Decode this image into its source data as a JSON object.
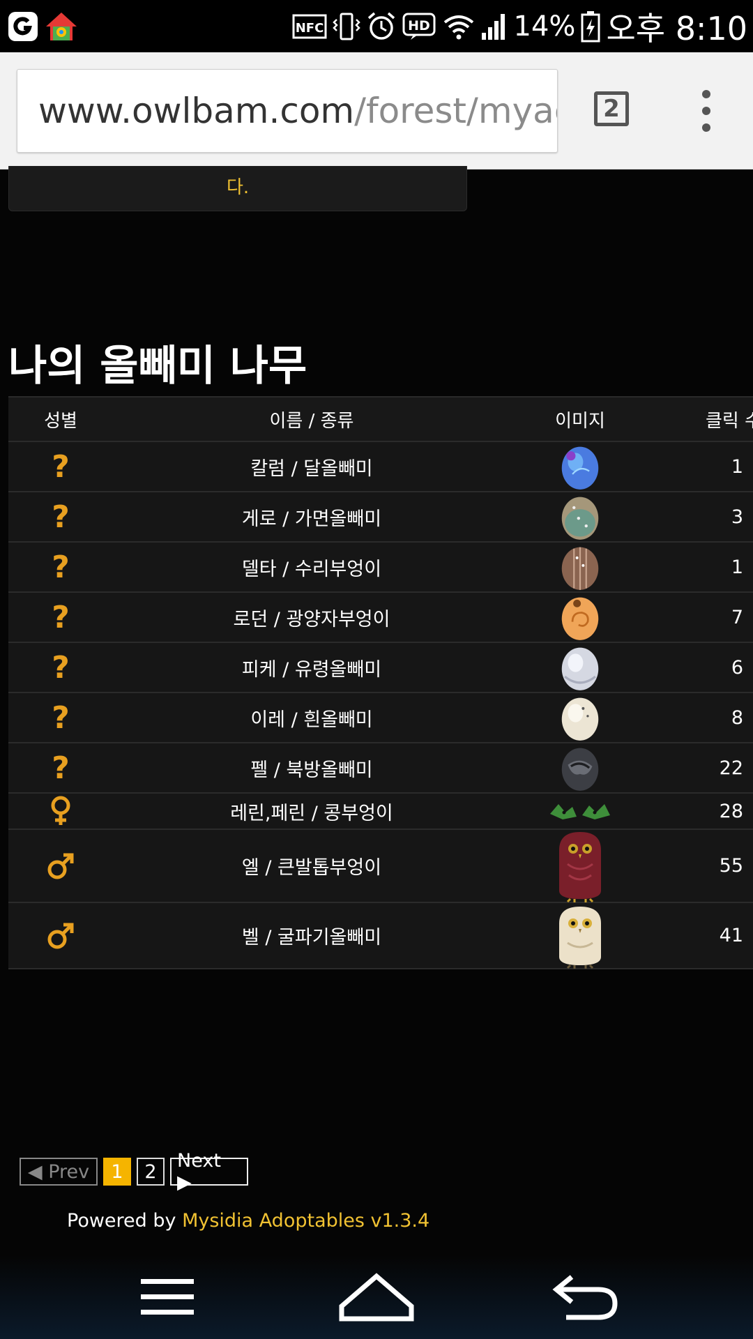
{
  "status_bar": {
    "left_icons": [
      "carrier-logo-icon",
      "home-launcher-icon"
    ],
    "right_icons": [
      "nfc-icon",
      "vibrate-icon",
      "alarm-icon",
      "hd-icon",
      "wifi-icon",
      "signal-icon",
      "battery-icon"
    ],
    "battery": "14%",
    "time": "오후 8:10"
  },
  "browser": {
    "url_domain": "www.owlbam.com",
    "url_path": "/forest/myac",
    "tab_count": "2"
  },
  "notice": {
    "text": "다."
  },
  "page": {
    "title": "나의 올빼미 나무"
  },
  "table": {
    "headers": {
      "gender": "성별",
      "name": "이름 / 종류",
      "image": "이미지",
      "clicks": "클릭 수"
    },
    "rows": [
      {
        "gender": "?",
        "name": "칼럼 / 달올빼미",
        "image": "blue-egg",
        "clicks": "1"
      },
      {
        "gender": "?",
        "name": "게로 / 가면올빼미",
        "image": "speckled-egg",
        "clicks": "3"
      },
      {
        "gender": "?",
        "name": "델타 / 수리부엉이",
        "image": "brown-egg",
        "clicks": "1"
      },
      {
        "gender": "?",
        "name": "로던 / 광양자부엉이",
        "image": "orange-egg",
        "clicks": "7"
      },
      {
        "gender": "?",
        "name": "피케 / 유령올빼미",
        "image": "white-egg",
        "clicks": "6"
      },
      {
        "gender": "?",
        "name": "이레 / 흰올빼미",
        "image": "cream-egg",
        "clicks": "8"
      },
      {
        "gender": "?",
        "name": "펠 / 북방올빼미",
        "image": "dark-egg",
        "clicks": "22"
      },
      {
        "gender": "♀",
        "name": "레린,페린 / 콩부엉이",
        "image": "twin-sprouts",
        "clicks": "28"
      },
      {
        "gender": "♂",
        "name": "엘 / 큰발톱부엉이",
        "image": "red-owl",
        "clicks": "55"
      },
      {
        "gender": "♂",
        "name": "벨 / 굴파기올빼미",
        "image": "cream-owl",
        "clicks": "41"
      }
    ]
  },
  "pagination": {
    "prev": "◀ Prev",
    "pages": [
      "1",
      "2"
    ],
    "next": "Next ▶"
  },
  "footer": {
    "prefix": "Powered by ",
    "link": "Mysidia Adoptables v1.3.4"
  },
  "nav_bar": [
    "menu-icon",
    "home-icon",
    "back-icon"
  ],
  "colors": {
    "accent": "#f5b400",
    "gender": "#e8a020",
    "link": "#f1c232"
  }
}
